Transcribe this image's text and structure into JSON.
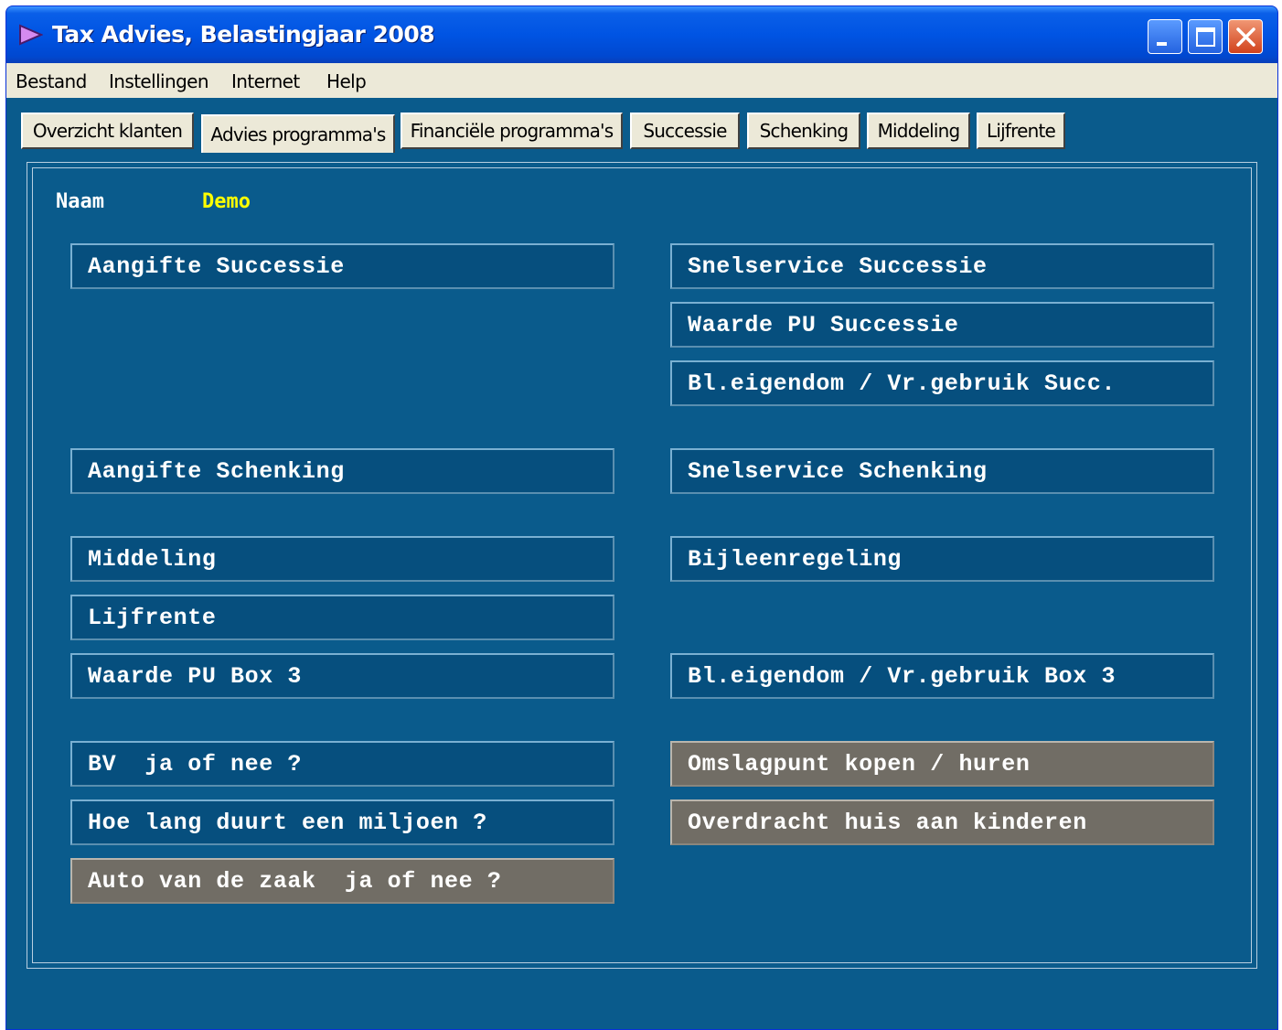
{
  "window": {
    "title": "Tax Advies, Belastingjaar 2008"
  },
  "menubar": {
    "items": [
      "Bestand",
      "Instellingen",
      "Internet",
      "Help"
    ]
  },
  "tabs": [
    {
      "label": "Overzicht klanten",
      "active": false
    },
    {
      "label": "Advies programma's",
      "active": true
    },
    {
      "label": "Financiële programma's",
      "active": false
    },
    {
      "label": "Successie",
      "active": false
    },
    {
      "label": "Schenking",
      "active": false
    },
    {
      "label": "Middeling",
      "active": false
    },
    {
      "label": "Lijfrente",
      "active": false
    }
  ],
  "client": {
    "label": "Naam",
    "value": "Demo"
  },
  "buttons": {
    "aangifte_successie": "Aangifte Successie",
    "snelservice_successie": "Snelservice Successie",
    "waarde_pu_successie": "Waarde PU Successie",
    "bl_eigendom_succ": "Bl.eigendom / Vr.gebruik Succ.",
    "aangifte_schenking": "Aangifte Schenking",
    "snelservice_schenking": "Snelservice Schenking",
    "middeling": "Middeling",
    "bijleenregeling": "Bijleenregeling",
    "lijfrente": "Lijfrente",
    "waarde_pu_box3": "Waarde PU Box 3",
    "bl_eigendom_box3": "Bl.eigendom / Vr.gebruik Box 3",
    "bv_ja_of_nee": "BV  ja of nee ?",
    "omslagpunt": "Omslagpunt kopen / huren",
    "hoe_lang_miljoen": "Hoe lang duurt een miljoen ?",
    "overdracht_huis": "Overdracht huis aan kinderen",
    "auto_van_de_zaak": "Auto van de zaak  ja of nee ?"
  },
  "colors": {
    "background": "#0a5b8c",
    "button": "#064f7e",
    "button_disabled": "#716d65",
    "name_value": "#ffff00",
    "titlebar": "#0054e3"
  }
}
